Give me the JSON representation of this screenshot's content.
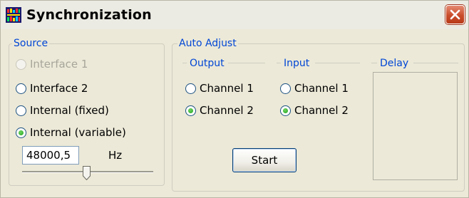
{
  "window": {
    "title": "Synchronization",
    "icon": "synchronization-app-icon",
    "close_icon": "close-icon"
  },
  "source": {
    "legend": "Source",
    "options": [
      {
        "label": "Interface 1",
        "selected": false,
        "enabled": false
      },
      {
        "label": "Interface 2",
        "selected": false,
        "enabled": true
      },
      {
        "label": "Internal (fixed)",
        "selected": false,
        "enabled": true
      },
      {
        "label": "Internal (variable)",
        "selected": true,
        "enabled": true
      }
    ],
    "frequency_value": "48000,5",
    "frequency_unit": "Hz"
  },
  "auto_adjust": {
    "legend": "Auto Adjust",
    "output": {
      "legend": "Output",
      "options": [
        {
          "label": "Channel 1",
          "selected": false
        },
        {
          "label": "Channel 2",
          "selected": true
        }
      ]
    },
    "input": {
      "legend": "Input",
      "options": [
        {
          "label": "Channel 1",
          "selected": false
        },
        {
          "label": "Channel 2",
          "selected": true
        }
      ]
    },
    "delay_legend": "Delay",
    "start_label": "Start"
  },
  "colors": {
    "legend_text": "#0046d5",
    "window_bg": "#ece9d8",
    "close_button": "#c94c2a",
    "radio_dot": "#21a121"
  }
}
